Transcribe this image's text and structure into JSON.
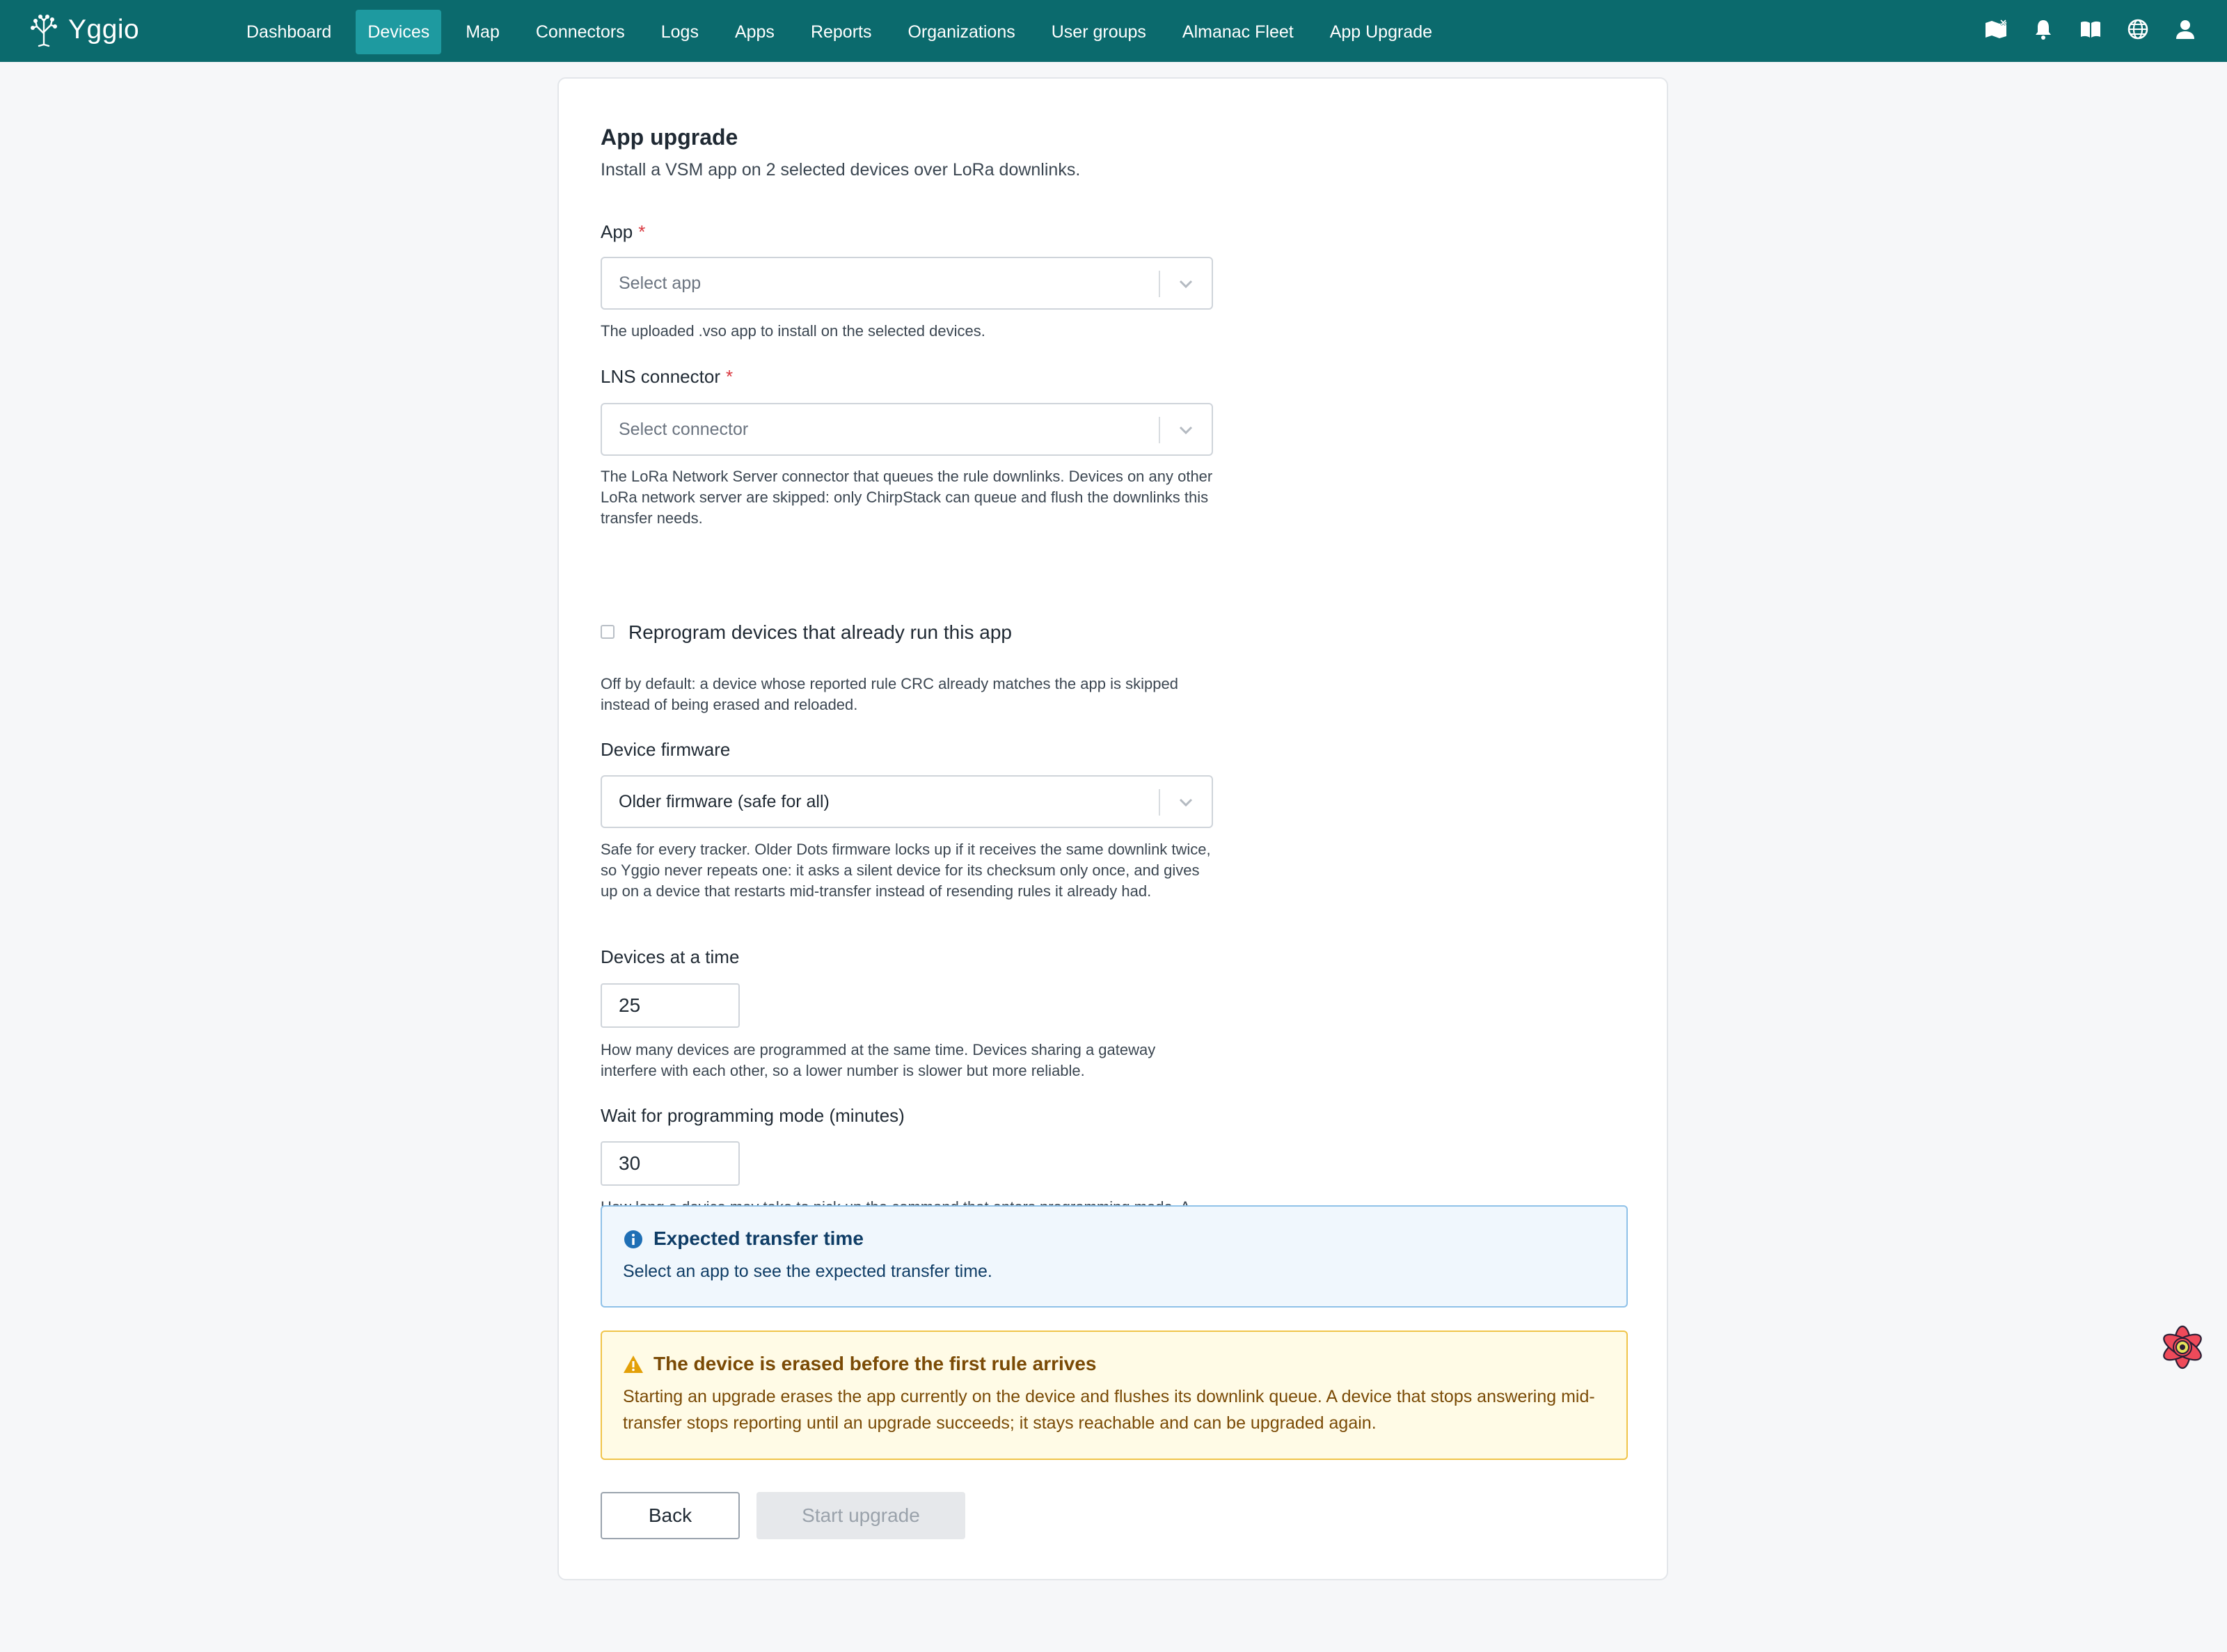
{
  "app": {
    "name": "Yggio"
  },
  "nav": {
    "items": [
      {
        "label": "Dashboard"
      },
      {
        "label": "Devices"
      },
      {
        "label": "Map"
      },
      {
        "label": "Connectors"
      },
      {
        "label": "Logs"
      },
      {
        "label": "Apps"
      },
      {
        "label": "Reports"
      },
      {
        "label": "Organizations"
      },
      {
        "label": "User groups"
      },
      {
        "label": "Almanac Fleet"
      },
      {
        "label": "App Upgrade"
      }
    ],
    "active_index": 1,
    "tools": [
      "map-off-icon",
      "bell-icon",
      "book-icon",
      "globe-icon",
      "user-icon"
    ]
  },
  "page": {
    "title": "App upgrade",
    "subtitle": "Install a VSM app on 2 selected devices over LoRa downlinks."
  },
  "form": {
    "app": {
      "label": "App",
      "required": "*",
      "placeholder": "Select app",
      "help": "The uploaded .vso app to install on the selected devices."
    },
    "connector": {
      "label": "LNS connector",
      "required": "*",
      "placeholder": "Select connector",
      "help": "The LoRa Network Server connector that queues the rule downlinks. Devices on any other LoRa network server are skipped: only ChirpStack can queue and flush the downlinks this transfer needs."
    },
    "reprogram": {
      "label": "Reprogram devices that already run this app",
      "checked": false,
      "help": "Off by default: a device whose reported rule CRC already matches the app is skipped instead of being erased and reloaded."
    },
    "firmware": {
      "label": "Device firmware",
      "value": "Older firmware (safe for all)",
      "help": "Safe for every tracker. Older Dots firmware locks up if it receives the same downlink twice, so Yggio never repeats one: it asks a silent device for its checksum only once, and gives up on a device that restarts mid-transfer instead of resending rules it already had."
    },
    "batch": {
      "label": "Devices at a time",
      "value": "25",
      "help": "How many devices are programmed at the same time. Devices sharing a gateway interfere with each other, so a lower number is slower but more reliable."
    },
    "wait": {
      "label": "Wait for programming mode (minutes)",
      "value": "30",
      "help": "How long a device may take to pick up the command that enters programming mode. A tracker only receives downlinks when it reports, so allow at least two report intervals."
    }
  },
  "info_alert": {
    "title": "Expected transfer time",
    "body": "Select an app to see the expected transfer time."
  },
  "warning_alert": {
    "title": "The device is erased before the first rule arrives",
    "body": "Starting an upgrade erases the app currently on the device and flushes its downlink queue. A device that stops answering mid-transfer stops reporting until an upgrade succeeds; it stays reachable and can be upgraded again."
  },
  "buttons": {
    "back": "Back",
    "start": "Start upgrade"
  },
  "colors": {
    "topbar": "#0b6a6d",
    "nav_active": "#1e9aa0",
    "info_border": "#8fc1e8",
    "warning_border": "#f0c44a",
    "required": "#d9363e"
  }
}
